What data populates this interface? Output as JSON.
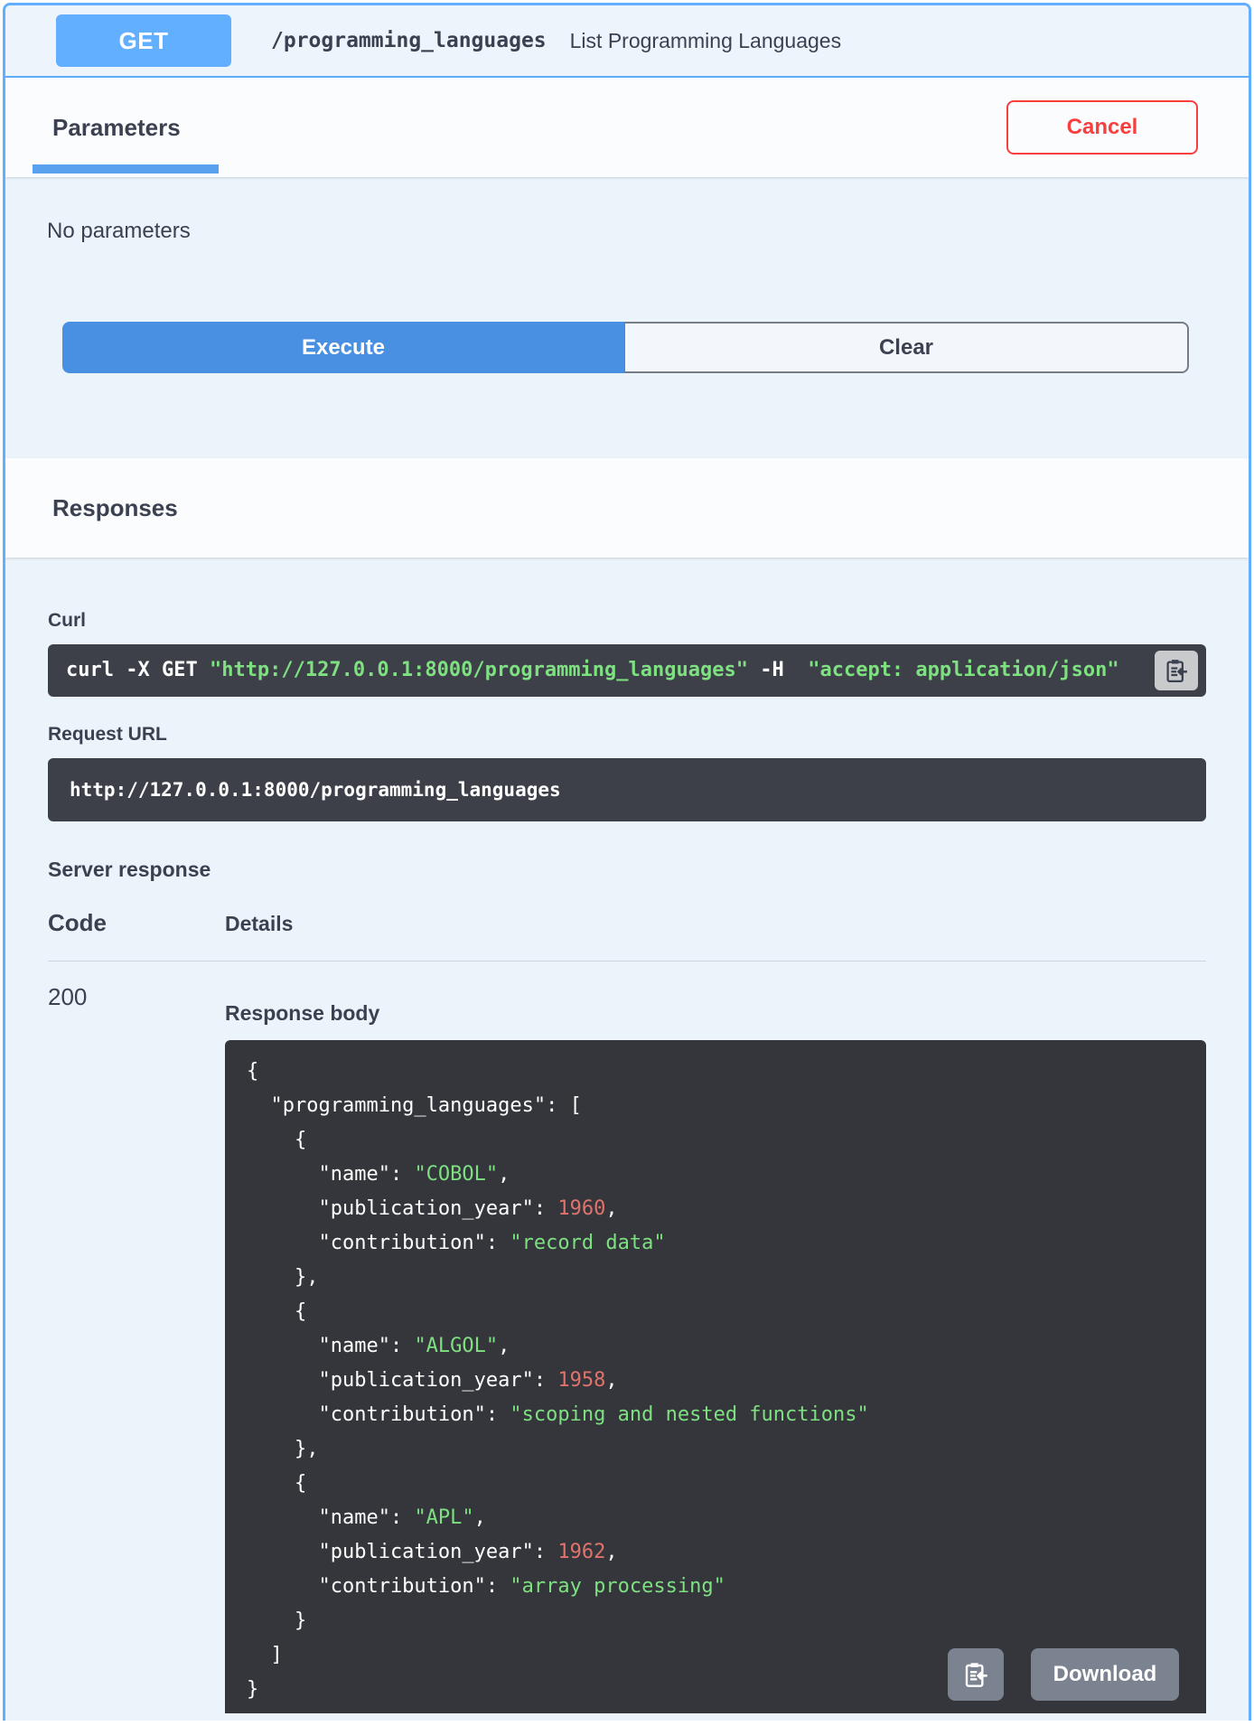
{
  "operation": {
    "method": "GET",
    "path": "/programming_languages",
    "summary": "List Programming Languages"
  },
  "parameters_section": {
    "tab_label": "Parameters",
    "cancel_label": "Cancel",
    "empty_message": "No parameters",
    "execute_label": "Execute",
    "clear_label": "Clear"
  },
  "responses_section": {
    "title": "Responses",
    "curl_label": "Curl",
    "request_url_label": "Request URL",
    "request_url": "http://127.0.0.1:8000/programming_languages",
    "server_response_label": "Server response",
    "code_header": "Code",
    "details_header": "Details",
    "status_code": "200",
    "response_body_label": "Response body",
    "download_label": "Download"
  },
  "curl": {
    "segments": [
      {
        "t": "p",
        "v": "curl -X GET "
      },
      {
        "t": "s",
        "v": "\"http://127.0.0.1:8000/programming_languages\""
      },
      {
        "t": "p",
        "v": " -H  "
      },
      {
        "t": "s",
        "v": "\"accept: application/json\""
      }
    ]
  },
  "response_body": {
    "lines": [
      [
        {
          "t": "p",
          "v": "{"
        }
      ],
      [
        {
          "t": "p",
          "v": "  \"programming_languages\": ["
        }
      ],
      [
        {
          "t": "p",
          "v": "    {"
        }
      ],
      [
        {
          "t": "p",
          "v": "      \"name\": "
        },
        {
          "t": "s",
          "v": "\"COBOL\""
        },
        {
          "t": "p",
          "v": ","
        }
      ],
      [
        {
          "t": "p",
          "v": "      \"publication_year\": "
        },
        {
          "t": "n",
          "v": "1960"
        },
        {
          "t": "p",
          "v": ","
        }
      ],
      [
        {
          "t": "p",
          "v": "      \"contribution\": "
        },
        {
          "t": "s",
          "v": "\"record data\""
        }
      ],
      [
        {
          "t": "p",
          "v": "    },"
        }
      ],
      [
        {
          "t": "p",
          "v": "    {"
        }
      ],
      [
        {
          "t": "p",
          "v": "      \"name\": "
        },
        {
          "t": "s",
          "v": "\"ALGOL\""
        },
        {
          "t": "p",
          "v": ","
        }
      ],
      [
        {
          "t": "p",
          "v": "      \"publication_year\": "
        },
        {
          "t": "n",
          "v": "1958"
        },
        {
          "t": "p",
          "v": ","
        }
      ],
      [
        {
          "t": "p",
          "v": "      \"contribution\": "
        },
        {
          "t": "s",
          "v": "\"scoping and nested functions\""
        }
      ],
      [
        {
          "t": "p",
          "v": "    },"
        }
      ],
      [
        {
          "t": "p",
          "v": "    {"
        }
      ],
      [
        {
          "t": "p",
          "v": "      \"name\": "
        },
        {
          "t": "s",
          "v": "\"APL\""
        },
        {
          "t": "p",
          "v": ","
        }
      ],
      [
        {
          "t": "p",
          "v": "      \"publication_year\": "
        },
        {
          "t": "n",
          "v": "1962"
        },
        {
          "t": "p",
          "v": ","
        }
      ],
      [
        {
          "t": "p",
          "v": "      \"contribution\": "
        },
        {
          "t": "s",
          "v": "\"array processing\""
        }
      ],
      [
        {
          "t": "p",
          "v": "    }"
        }
      ],
      [
        {
          "t": "p",
          "v": "  ]"
        }
      ],
      [
        {
          "t": "p",
          "v": "}"
        }
      ]
    ]
  },
  "icons": {
    "curl_copy": "clipboard-copy-icon",
    "body_copy": "clipboard-copy-icon"
  },
  "colors": {
    "method_badge": "#61affe",
    "block_border": "#61affe",
    "panel_bg": "#ebf3fb",
    "execute_blue": "#4a90e2",
    "tab_underline": "#58a1ef",
    "cancel_red": "#f93e3e",
    "heading_text": "#3b4151",
    "code_block_bg": "#3d4049",
    "response_body_bg": "#34363c",
    "json_string_green": "#7ee081",
    "json_number_red": "#e0736c",
    "action_chip_gray": "#7b8290"
  }
}
